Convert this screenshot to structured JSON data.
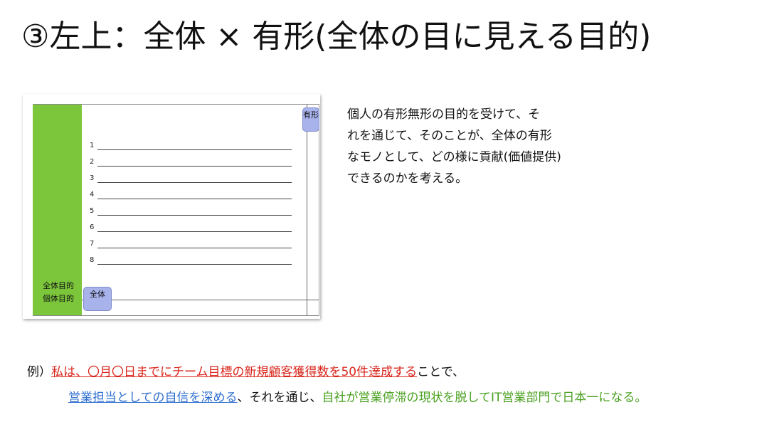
{
  "slide": {
    "title": "③左上：全体 × 有形(全体の目に見える目的)"
  },
  "figure": {
    "green_label_line1": "全体目的",
    "green_label_line2": "個体目的",
    "tab_top_label": "有形",
    "tab_bottom_label": "全体",
    "line_numbers": [
      "1",
      "2",
      "3",
      "4",
      "5",
      "6",
      "7",
      "8"
    ],
    "colors": {
      "green_band": "#7cc63c",
      "tab_fill": "#a8b3ec"
    }
  },
  "description": {
    "lines": [
      "個人の有形無形の目的を受けて、そ",
      "れを通じて、そのことが、全体の有形",
      "なモノとして、どの様に貢献(価値提供)",
      "できるのかを考える。"
    ]
  },
  "example": {
    "prefix": "例）",
    "red_part": "私は、〇月〇日までにチーム目標の新規顧客獲得数を50件達成する",
    "after_red": "ことで、",
    "blue_part": "営業担当としての自信を深める",
    "middle": "、それを通じ、",
    "green_part": "自社が営業停滞の現状を脱してIT営業部門で日本一になる。",
    "colors": {
      "red": "#d9261c",
      "blue": "#2f6fd0",
      "green": "#4aa020"
    }
  }
}
